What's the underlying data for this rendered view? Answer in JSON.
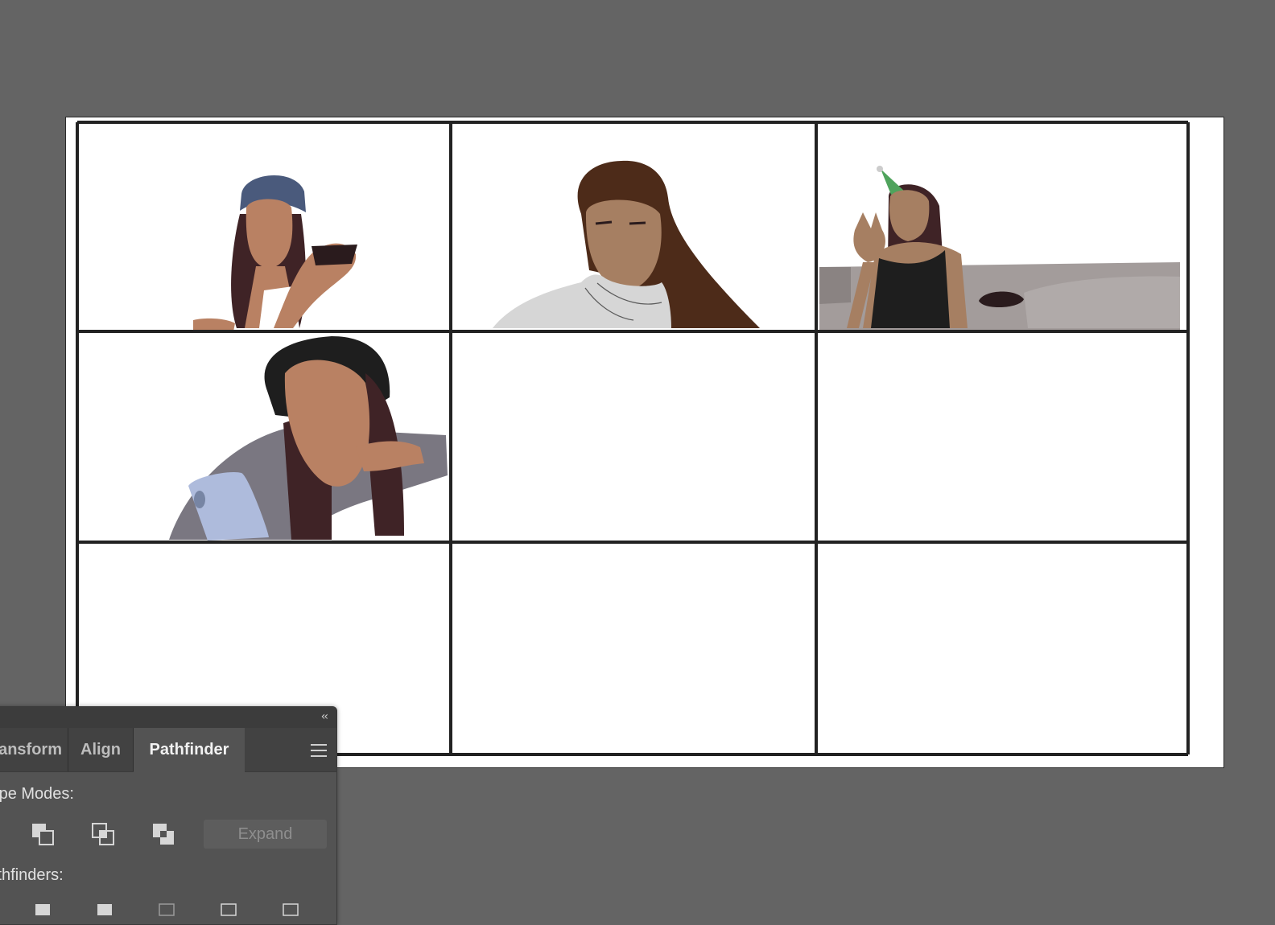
{
  "panel": {
    "tabs": [
      {
        "label": "Transform"
      },
      {
        "label": "Align"
      },
      {
        "label": "Pathfinder"
      }
    ],
    "active_tab": "Pathfinder",
    "shape_modes_label": "Shape Modes:",
    "pathfinders_label": "Pathfinders:",
    "expand_label": "Expand",
    "collapse_icon": "double-chevron-left-icon",
    "menu_icon": "hamburger-menu-icon"
  },
  "artboard": {
    "grid": {
      "rows": 3,
      "columns": 3
    },
    "filled_cells": 4,
    "empty_cells": 5
  },
  "colors": {
    "canvas": "#646464",
    "artboard": "#ffffff",
    "grid_line": "#222222",
    "panel_bg": "#535353",
    "panel_tab_bar": "#424242",
    "skin_light": "#b98163",
    "skin_mid": "#a67f62",
    "hair_dark": "#3f2326",
    "hair_brown": "#4d2b19",
    "cap_blue": "#4a5a7c",
    "hoodie_gray": "#d6d6d6",
    "sweater_gray": "#7a7781",
    "phone_blue": "#aebbdc",
    "party_hat_green": "#4fa35c",
    "tank_black": "#1e1e1e",
    "couch_gray": "#a39c9b"
  }
}
